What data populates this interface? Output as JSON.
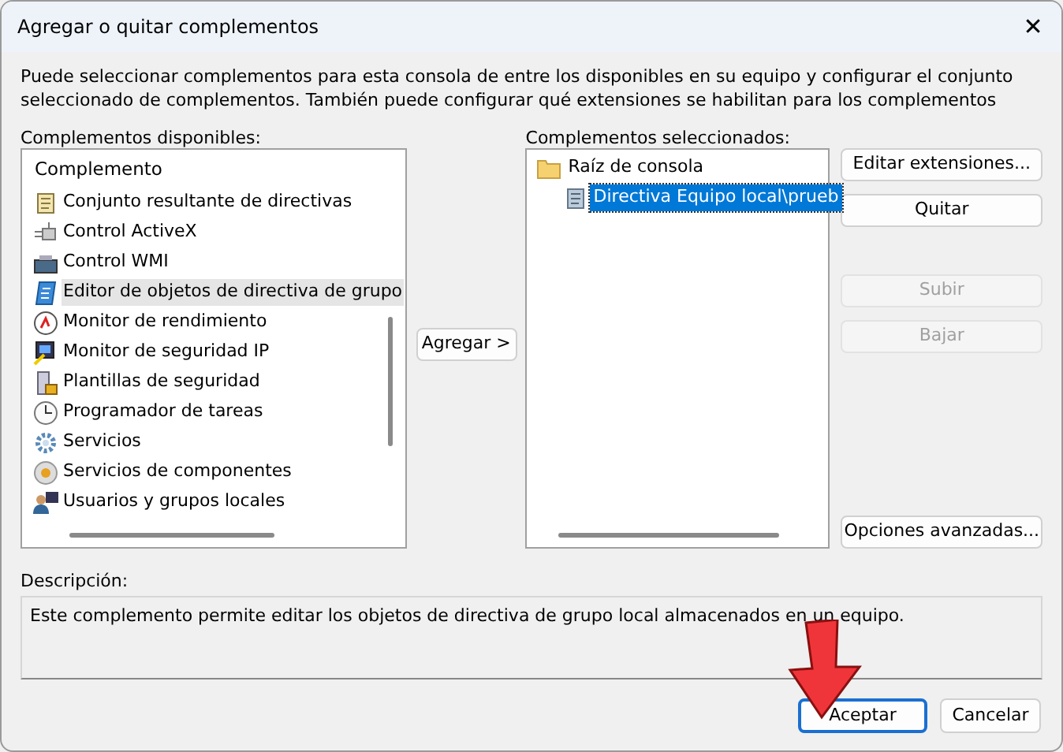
{
  "window": {
    "title": "Agregar o quitar complementos",
    "close": "✕"
  },
  "intro": "Puede seleccionar complementos para esta consola de entre los disponibles en su equipo y configurar el conjunto seleccionado de complementos. También puede configurar qué extensiones se habilitan para los complementos",
  "available": {
    "label": "Complementos disponibles:",
    "column": "Complemento",
    "items": [
      {
        "label": "Conjunto resultante de directivas",
        "selected": false
      },
      {
        "label": "Control ActiveX",
        "selected": false
      },
      {
        "label": "Control WMI",
        "selected": false
      },
      {
        "label": "Editor de objetos de directiva de grupo",
        "selected": true
      },
      {
        "label": "Monitor de rendimiento",
        "selected": false
      },
      {
        "label": "Monitor de seguridad IP",
        "selected": false
      },
      {
        "label": "Plantillas de seguridad",
        "selected": false
      },
      {
        "label": "Programador de tareas",
        "selected": false
      },
      {
        "label": "Servicios",
        "selected": false
      },
      {
        "label": "Servicios de componentes",
        "selected": false
      },
      {
        "label": "Usuarios y grupos locales",
        "selected": false
      }
    ]
  },
  "add_button": "Agregar >",
  "selected_snapins": {
    "label": "Complementos seleccionados:",
    "tree": [
      {
        "label": "Raíz de consola",
        "selected": false,
        "children": [
          {
            "label": "Directiva Equipo local\\prueb",
            "selected": true
          }
        ]
      }
    ]
  },
  "side_buttons": [
    {
      "label": "Editar extensiones...",
      "disabled": false
    },
    {
      "label": "Quitar",
      "disabled": false
    },
    {
      "label": "Subir",
      "disabled": true
    },
    {
      "label": "Bajar",
      "disabled": true
    }
  ],
  "advanced_button": "Opciones avanzadas...",
  "description": {
    "label": "Descripción:",
    "text": "Este complemento permite editar los objetos de directiva de grupo local almacenados en un equipo."
  },
  "footer_buttons": [
    {
      "label": "Aceptar",
      "default": true
    },
    {
      "label": "Cancelar",
      "default": false
    }
  ]
}
